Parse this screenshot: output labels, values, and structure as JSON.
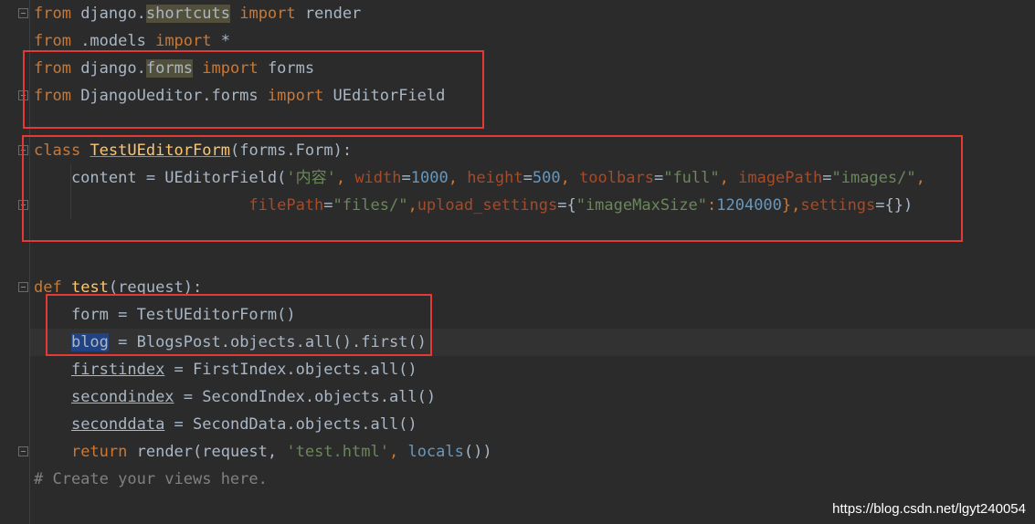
{
  "editor": {
    "lines": {
      "l1": {
        "kw1": "from",
        "mod": " django",
        "dot": ".",
        "sub": "shortcuts",
        "kw2": " import",
        "name": " render"
      },
      "l2": {
        "kw1": "from",
        "mod": " .models",
        "kw2": " import",
        "name": " *"
      },
      "l3": {
        "kw1": "from",
        "mod": " django",
        "dot": ".",
        "sub": "forms",
        "kw2": " import",
        "name": " forms"
      },
      "l4": {
        "kw1": "from",
        "mod": " DjangoUeditor.forms",
        "kw2": " import",
        "name": " UEditorField"
      },
      "l6": {
        "kw": "class",
        "sp": " ",
        "cls": "TestUEditorForm",
        "open": "(",
        "base": "forms.Form",
        "close": "):"
      },
      "l7": {
        "a": "    content = UEditorField(",
        "s1": "'内容'",
        "c1": ", ",
        "p1": "width",
        "e1": "=",
        "n1": "1000",
        "c2": ", ",
        "p2": "height",
        "e2": "=",
        "n2": "500",
        "c3": ", ",
        "p3": "toolbars",
        "e3": "=",
        "s2": "\"full\"",
        "c4": ", ",
        "p4": "imagePath",
        "e4": "=",
        "s3": "\"images/\"",
        "c5": ","
      },
      "l8": {
        "a": "                       ",
        "p1": "filePath",
        "e1": "=",
        "s1": "\"files/\"",
        "c1": ",",
        "p2": "upload_settings",
        "e2": "={",
        "s2": "\"imageMaxSize\"",
        "c2": ":",
        "n1": "1204000",
        "c3": "},",
        "p3": "settings",
        "e3": "={})"
      },
      "l11": {
        "kw": "def",
        "sp": " ",
        "fn": "test",
        "args": "(request):"
      },
      "l12": {
        "a": "    form = TestUEditorForm()"
      },
      "l13": {
        "ind": "    ",
        "var": "blog",
        "rest": " = BlogsPost.objects.all().first()"
      },
      "l14": {
        "ind": "    ",
        "var": "firstindex",
        "rest": " = FirstIndex.objects.all()"
      },
      "l15": {
        "ind": "    ",
        "var": "secondindex",
        "rest": " = SecondIndex.objects.all()"
      },
      "l16": {
        "ind": "    ",
        "var": "seconddata",
        "rest": " = SecondData.objects.all()"
      },
      "l17": {
        "ind": "    ",
        "kw": "return",
        "a": " render(request, ",
        "s1": "'test.html'",
        "c1": ", ",
        "bi": "locals",
        "end": "())"
      },
      "l18": {
        "cmt": "# Create your views here."
      }
    }
  },
  "watermark": "https://blog.csdn.net/lgyt240054",
  "colors": {
    "background": "#2b2b2b",
    "keyword": "#cc7832",
    "string": "#6a8759",
    "number": "#6897bb",
    "comment": "#808080",
    "function": "#ffc66d",
    "text": "#a9b7c6",
    "annotation_box": "#e53935"
  }
}
